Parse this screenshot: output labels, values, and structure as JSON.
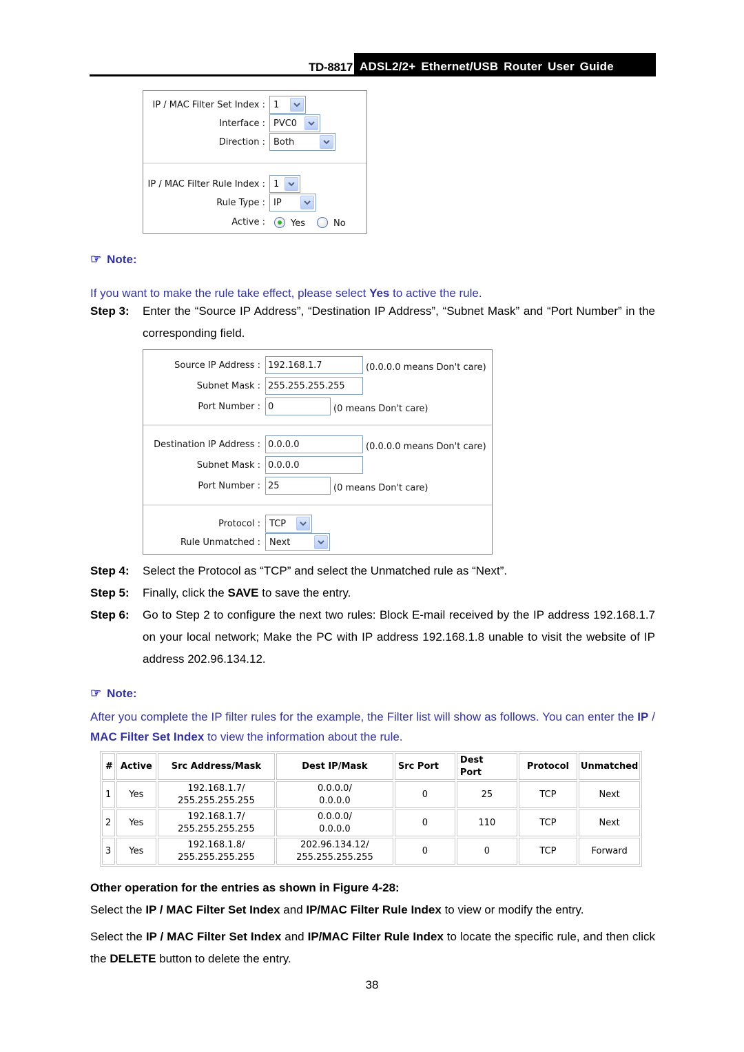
{
  "header": {
    "model": "TD-8817",
    "title": "ADSL2/2+ Ethernet/USB Router User Guide"
  },
  "form1": {
    "set_index_label": "IP / MAC Filter Set Index :",
    "set_index_value": "1",
    "interface_label": "Interface :",
    "interface_value": "PVC0",
    "direction_label": "Direction :",
    "direction_value": "Both",
    "rule_index_label": "IP / MAC Filter Rule Index :",
    "rule_index_value": "1",
    "rule_type_label": "Rule Type :",
    "rule_type_value": "IP",
    "active_label": "Active :",
    "active_yes": "Yes",
    "active_no": "No",
    "active_selected": "Yes"
  },
  "note1": {
    "heading": "Note:",
    "text_before": "If you want to make the rule take effect, please select ",
    "text_bold": "Yes",
    "text_after": " to active the rule."
  },
  "steps": {
    "step3_label": "Step 3:",
    "step3_text": "Enter the “Source IP Address”, “Destination IP Address”, “Subnet Mask” and “Port Number” in the corresponding field.",
    "step4_label": "Step 4:",
    "step4_text": "Select the Protocol as “TCP” and select the Unmatched rule as “Next”.",
    "step5_label": "Step 5:",
    "step5_before": "Finally, click the ",
    "step5_bold": "SAVE",
    "step5_after": " to save the entry.",
    "step6_label": "Step 6:",
    "step6_text": "Go to Step 2 to configure the next two rules: Block E-mail received by the IP address 192.168.1.7 on your local network; Make the PC with IP address 192.168.1.8 unable to visit the website of IP address 202.96.134.12."
  },
  "form2": {
    "src_ip_label": "Source IP Address :",
    "src_ip_value": "192.168.1.7",
    "src_ip_hint": "(0.0.0.0 means Don't care)",
    "src_mask_label": "Subnet Mask :",
    "src_mask_value": "255.255.255.255",
    "src_port_label": "Port Number :",
    "src_port_value": "0",
    "src_port_hint": "(0 means Don't care)",
    "dst_ip_label": "Destination IP Address :",
    "dst_ip_value": "0.0.0.0",
    "dst_ip_hint": "(0.0.0.0 means Don't care)",
    "dst_mask_label": "Subnet Mask :",
    "dst_mask_value": "0.0.0.0",
    "dst_port_label": "Port Number :",
    "dst_port_value": "25",
    "dst_port_hint": "(0 means Don't care)",
    "protocol_label": "Protocol :",
    "protocol_value": "TCP",
    "unmatched_label": "Rule Unmatched :",
    "unmatched_value": "Next"
  },
  "note2": {
    "heading": "Note:",
    "text_1": "After you complete the IP filter rules for the example, the Filter list will show as follows. You can enter the ",
    "text_bold_1": "IP",
    "text_2": " / ",
    "text_bold_2": "MAC Filter Set Index",
    "text_3": " to view the information about the rule."
  },
  "filter_table": {
    "headers": [
      "#",
      "Active",
      "Src Address/Mask",
      "Dest IP/Mask",
      "Src Port",
      "Dest Port",
      "Protocol",
      "Unmatched"
    ],
    "rows": [
      {
        "num": "1",
        "active": "Yes",
        "src_ip": "192.168.1.7/",
        "src_mask": "255.255.255.255",
        "dst_ip": "0.0.0.0/",
        "dst_mask": "0.0.0.0",
        "src_port": "0",
        "dst_port": "25",
        "protocol": "TCP",
        "unmatched": "Next"
      },
      {
        "num": "2",
        "active": "Yes",
        "src_ip": "192.168.1.7/",
        "src_mask": "255.255.255.255",
        "dst_ip": "0.0.0.0/",
        "dst_mask": "0.0.0.0",
        "src_port": "0",
        "dst_port": "110",
        "protocol": "TCP",
        "unmatched": "Next"
      },
      {
        "num": "3",
        "active": "Yes",
        "src_ip": "192.168.1.8/",
        "src_mask": "255.255.255.255",
        "dst_ip": "202.96.134.12/",
        "dst_mask": "255.255.255.255",
        "src_port": "0",
        "dst_port": "0",
        "protocol": "TCP",
        "unmatched": "Forward"
      }
    ]
  },
  "other_ops": {
    "heading": "Other operation for the entries as shown in Figure 4-28:",
    "p1_a": "Select the ",
    "p1_b": "IP / MAC Filter Set Index",
    "p1_c": " and ",
    "p1_d": "IP/MAC Filter Rule Index",
    "p1_e": " to view or modify the entry.",
    "p2_a": "Select the ",
    "p2_b": "IP / MAC Filter Set Index",
    "p2_c": " and ",
    "p2_d": "IP/MAC Filter Rule Index",
    "p2_e": " to locate the specific rule, and then click the ",
    "p2_f": "DELETE",
    "p2_g": " button to delete the entry."
  },
  "page_number": "38",
  "colors": {
    "note_blue": "#333399",
    "input_border": "#7f9db9"
  }
}
